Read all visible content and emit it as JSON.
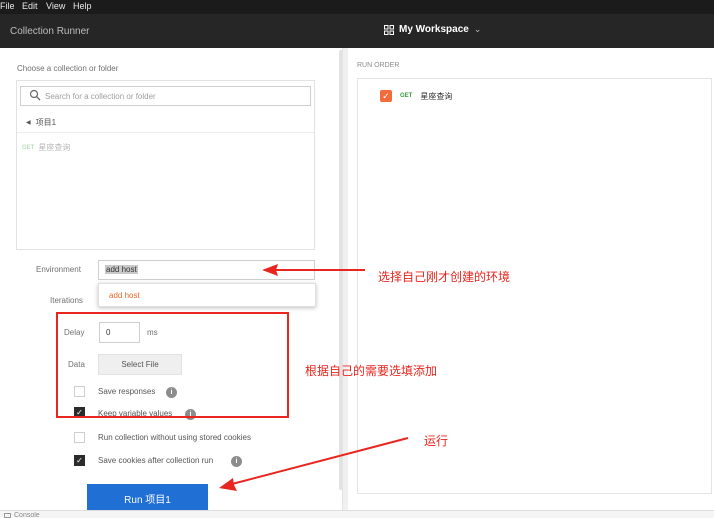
{
  "menubar": {
    "items": [
      "File",
      "Edit",
      "View",
      "Help"
    ]
  },
  "titlebar": {
    "app_title": "Collection Runner",
    "workspace": "My Workspace"
  },
  "collection_picker": {
    "label": "Choose a collection or folder",
    "search_placeholder": "Search for a collection or folder",
    "current_collection": "项目1",
    "requests": [
      {
        "method": "GET",
        "name": "星座查询"
      }
    ]
  },
  "environment": {
    "label": "Environment",
    "selected": "add host",
    "options": [
      "add host"
    ]
  },
  "iterations": {
    "label": "Iterations"
  },
  "delay": {
    "label": "Delay",
    "value": "0",
    "unit": "ms"
  },
  "data": {
    "label": "Data",
    "button_label": "Select File"
  },
  "options": [
    {
      "label": "Save responses",
      "checked": false,
      "info": true
    },
    {
      "label": "Keep variable values",
      "checked": true,
      "info": true
    },
    {
      "label": "Run collection without using stored cookies",
      "checked": false,
      "info": false
    },
    {
      "label": "Save cookies after collection run",
      "checked": true,
      "info": true
    }
  ],
  "run_button": {
    "label": "Run 项目1"
  },
  "run_order": {
    "title": "RUN ORDER",
    "items": [
      {
        "method": "GET",
        "name": "星座查询",
        "checked": true
      }
    ]
  },
  "statusbar": {
    "console_label": "Console"
  },
  "annotations": {
    "environment_note": "选择自己刚才创建的环境",
    "options_note": "根据自己的需要选填添加",
    "run_note": "运行"
  },
  "colors": {
    "accent_orange": "#f26b3a",
    "run_blue": "#1f6fd4",
    "annotation_red": "#e8261f",
    "method_green": "#3a9a3a"
  }
}
